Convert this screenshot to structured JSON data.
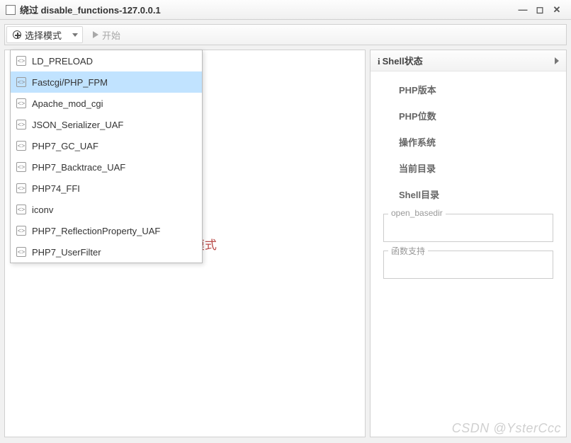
{
  "window": {
    "title": "绕过 disable_functions-127.0.0.1"
  },
  "toolbar": {
    "select_mode_label": "选择模式",
    "start_label": "开始"
  },
  "hint_text": "钮,选择模式",
  "dropdown": {
    "items": [
      {
        "label": "LD_PRELOAD",
        "selected": false
      },
      {
        "label": "Fastcgi/PHP_FPM",
        "selected": true
      },
      {
        "label": "Apache_mod_cgi",
        "selected": false
      },
      {
        "label": "JSON_Serializer_UAF",
        "selected": false
      },
      {
        "label": "PHP7_GC_UAF",
        "selected": false
      },
      {
        "label": "PHP7_Backtrace_UAF",
        "selected": false
      },
      {
        "label": "PHP74_FFI",
        "selected": false
      },
      {
        "label": "iconv",
        "selected": false
      },
      {
        "label": "PHP7_ReflectionProperty_UAF",
        "selected": false
      },
      {
        "label": "PHP7_UserFilter",
        "selected": false
      }
    ]
  },
  "right_panel": {
    "header_prefix": "i",
    "header_text": "Shell状态",
    "rows": [
      "PHP版本",
      "PHP位数",
      "操作系统",
      "当前目录",
      "Shell目录"
    ],
    "fieldset1": "open_basedir",
    "fieldset2": "函数支持"
  },
  "watermark": "CSDN @YsterCcc"
}
